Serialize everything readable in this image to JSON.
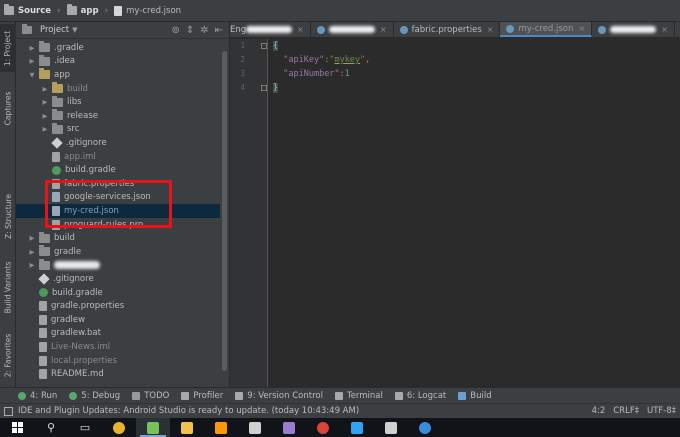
{
  "breadcrumb": {
    "items": [
      "Source",
      "app",
      "my-cred.json"
    ]
  },
  "left_strip": {
    "tabs": [
      "1: Project",
      "Captures",
      "Z: Structure",
      "Build Variants",
      "2: Favorites"
    ]
  },
  "project_panel": {
    "title": "Project",
    "tree": [
      {
        "label": ".gradle",
        "type": "folder",
        "depth": 1,
        "expanded": false
      },
      {
        "label": ".idea",
        "type": "folder",
        "depth": 1,
        "expanded": false
      },
      {
        "label": "app",
        "type": "folder",
        "depth": 1,
        "expanded": true
      },
      {
        "label": "build",
        "type": "folder",
        "depth": 2,
        "expanded": false,
        "muted": true
      },
      {
        "label": "libs",
        "type": "folder",
        "depth": 2,
        "expanded": false
      },
      {
        "label": "release",
        "type": "folder",
        "depth": 2,
        "expanded": false
      },
      {
        "label": "src",
        "type": "folder",
        "depth": 2,
        "expanded": false
      },
      {
        "label": ".gitignore",
        "type": "git",
        "depth": 2
      },
      {
        "label": "app.iml",
        "type": "file",
        "depth": 2,
        "muted": true
      },
      {
        "label": "build.gradle",
        "type": "gradle",
        "depth": 2
      },
      {
        "label": "fabric.properties",
        "type": "file",
        "depth": 2
      },
      {
        "label": "google-services.json",
        "type": "json",
        "depth": 2
      },
      {
        "label": "my-cred.json",
        "type": "json",
        "depth": 2,
        "selected": true
      },
      {
        "label": "proguard-rules.pro",
        "type": "file",
        "depth": 2
      },
      {
        "label": "build",
        "type": "folder",
        "depth": 1,
        "expanded": false
      },
      {
        "label": "gradle",
        "type": "folder",
        "depth": 1,
        "expanded": false
      },
      {
        "label": "",
        "type": "folder",
        "depth": 1,
        "expanded": false,
        "redacted": true
      },
      {
        "label": ".gitignore",
        "type": "git",
        "depth": 1
      },
      {
        "label": "build.gradle",
        "type": "gradle",
        "depth": 1
      },
      {
        "label": "gradle.properties",
        "type": "file",
        "depth": 1
      },
      {
        "label": "gradlew",
        "type": "file",
        "depth": 1
      },
      {
        "label": "gradlew.bat",
        "type": "file",
        "depth": 1
      },
      {
        "label": "Live-News.iml",
        "type": "file",
        "depth": 1,
        "muted": true
      },
      {
        "label": "local.properties",
        "type": "file",
        "depth": 1,
        "muted": true
      },
      {
        "label": "README.md",
        "type": "file",
        "depth": 1
      }
    ]
  },
  "editor_tabs": [
    {
      "label": "Eng",
      "redacted": true
    },
    {
      "label": "",
      "redacted": true
    },
    {
      "label": "fabric.properties"
    },
    {
      "label": "my-cred.json",
      "active": true
    },
    {
      "label": "",
      "redacted": true
    }
  ],
  "editor": {
    "line_numbers": [
      "1",
      "2",
      "3",
      "4"
    ],
    "lines": [
      [
        {
          "t": "{",
          "c": "brace"
        }
      ],
      [
        {
          "t": "  ",
          "c": ""
        },
        {
          "t": "\"apiKey\"",
          "c": "key"
        },
        {
          "t": ":",
          "c": "punc"
        },
        {
          "t": "\"",
          "c": "str"
        },
        {
          "t": "mykey",
          "c": "kval"
        },
        {
          "t": "\"",
          "c": "str"
        },
        {
          "t": ",",
          "c": "punc"
        }
      ],
      [
        {
          "t": "  ",
          "c": ""
        },
        {
          "t": "\"apiNumber\"",
          "c": "key"
        },
        {
          "t": ":",
          "c": "punc"
        },
        {
          "t": "1",
          "c": "num"
        }
      ],
      [
        {
          "t": "}",
          "c": "brace"
        }
      ]
    ]
  },
  "tool_windows": [
    "4: Run",
    "5: Debug",
    "TODO",
    "Profiler",
    "9: Version Control",
    "Terminal",
    "6: Logcat",
    "Build"
  ],
  "status": {
    "message": "IDE and Plugin Updates: Android Studio is ready to update. (today 10:43:49 AM)",
    "position": "4:2",
    "line_sep": "CRLF",
    "encoding": "UTF-8"
  },
  "taskbar": {
    "items": [
      "start",
      "search",
      "task-view",
      "chrome",
      "android-studio",
      "file-explorer",
      "sublime",
      "store",
      "app",
      "chrome-notify",
      "photoshop",
      "calculator",
      "edge"
    ]
  },
  "colors": {
    "highlight_box": "#e8121b",
    "selection": "#0d293e",
    "accent": "#4a88c7"
  }
}
